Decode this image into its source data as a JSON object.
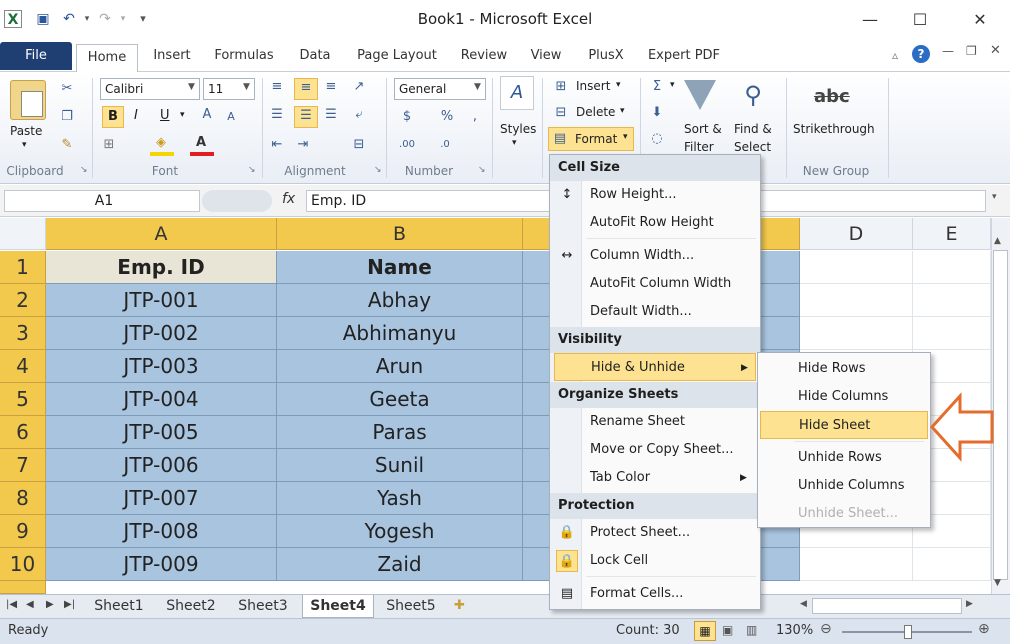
{
  "window": {
    "title": "Book1  -  Microsoft Excel",
    "minimize": "—",
    "maximize": "☐",
    "close": "✕"
  },
  "tabs": [
    {
      "label": "File"
    },
    {
      "label": "Home"
    },
    {
      "label": "Insert"
    },
    {
      "label": "Formulas"
    },
    {
      "label": "Data"
    },
    {
      "label": "Page Layout"
    },
    {
      "label": "Review"
    },
    {
      "label": "View"
    },
    {
      "label": "PlusX"
    },
    {
      "label": "Expert PDF"
    }
  ],
  "ribbon": {
    "paste": "Paste",
    "font_name": "Calibri",
    "font_size": "11",
    "bold": "B",
    "italic": "I",
    "underline": "U",
    "number_format": "General",
    "styles": "Styles",
    "insert": "Insert",
    "delete": "Delete",
    "format": "Format",
    "sort_filter_1": "Sort &",
    "sort_filter_2": "Filter",
    "find_select_1": "Find &",
    "find_select_2": "Select",
    "strikethrough": "Strikethrough",
    "groups": {
      "clipboard": "Clipboard",
      "font": "Font",
      "alignment": "Alignment",
      "number": "Number",
      "new_group": "New Group"
    }
  },
  "formula_bar": {
    "name_box": "A1",
    "fx": "fx",
    "value": "Emp. ID"
  },
  "grid": {
    "columns": [
      "A",
      "B",
      "D",
      "E"
    ],
    "rows": [
      {
        "num": "1",
        "a": "Emp. ID",
        "b": "Name"
      },
      {
        "num": "2",
        "a": "JTP-001",
        "b": "Abhay"
      },
      {
        "num": "3",
        "a": "JTP-002",
        "b": "Abhimanyu"
      },
      {
        "num": "4",
        "a": "JTP-003",
        "b": "Arun"
      },
      {
        "num": "5",
        "a": "JTP-004",
        "b": "Geeta"
      },
      {
        "num": "6",
        "a": "JTP-005",
        "b": "Paras"
      },
      {
        "num": "7",
        "a": "JTP-006",
        "b": "Sunil"
      },
      {
        "num": "8",
        "a": "JTP-007",
        "b": "Yash"
      },
      {
        "num": "9",
        "a": "JTP-008",
        "b": "Yogesh"
      },
      {
        "num": "10",
        "a": "JTP-009",
        "b": "Zaid"
      }
    ]
  },
  "format_menu": {
    "cell_size": "Cell Size",
    "row_height": "Row Height...",
    "autofit_row_height": "AutoFit Row Height",
    "column_width": "Column Width...",
    "autofit_column_width": "AutoFit Column Width",
    "default_width": "Default Width...",
    "visibility": "Visibility",
    "hide_unhide": "Hide & Unhide",
    "organize_sheets": "Organize Sheets",
    "rename_sheet": "Rename Sheet",
    "move_copy_sheet": "Move or Copy Sheet...",
    "tab_color": "Tab Color",
    "protection": "Protection",
    "protect_sheet": "Protect Sheet...",
    "lock_cell": "Lock Cell",
    "format_cells": "Format Cells..."
  },
  "hide_unhide_menu": {
    "hide_rows": "Hide Rows",
    "hide_columns": "Hide Columns",
    "hide_sheet": "Hide Sheet",
    "unhide_rows": "Unhide Rows",
    "unhide_columns": "Unhide Columns",
    "unhide_sheet": "Unhide Sheet..."
  },
  "sheets": [
    "Sheet1",
    "Sheet2",
    "Sheet3",
    "Sheet4",
    "Sheet5"
  ],
  "active_sheet": "Sheet4",
  "status": {
    "ready": "Ready",
    "count": "Count: 30",
    "zoom": "130%"
  },
  "colors": {
    "selection": "#a8c4de",
    "header_highlight": "#f2c94c",
    "menu_highlight": "#fde391",
    "arrow": "#e46c2c"
  }
}
